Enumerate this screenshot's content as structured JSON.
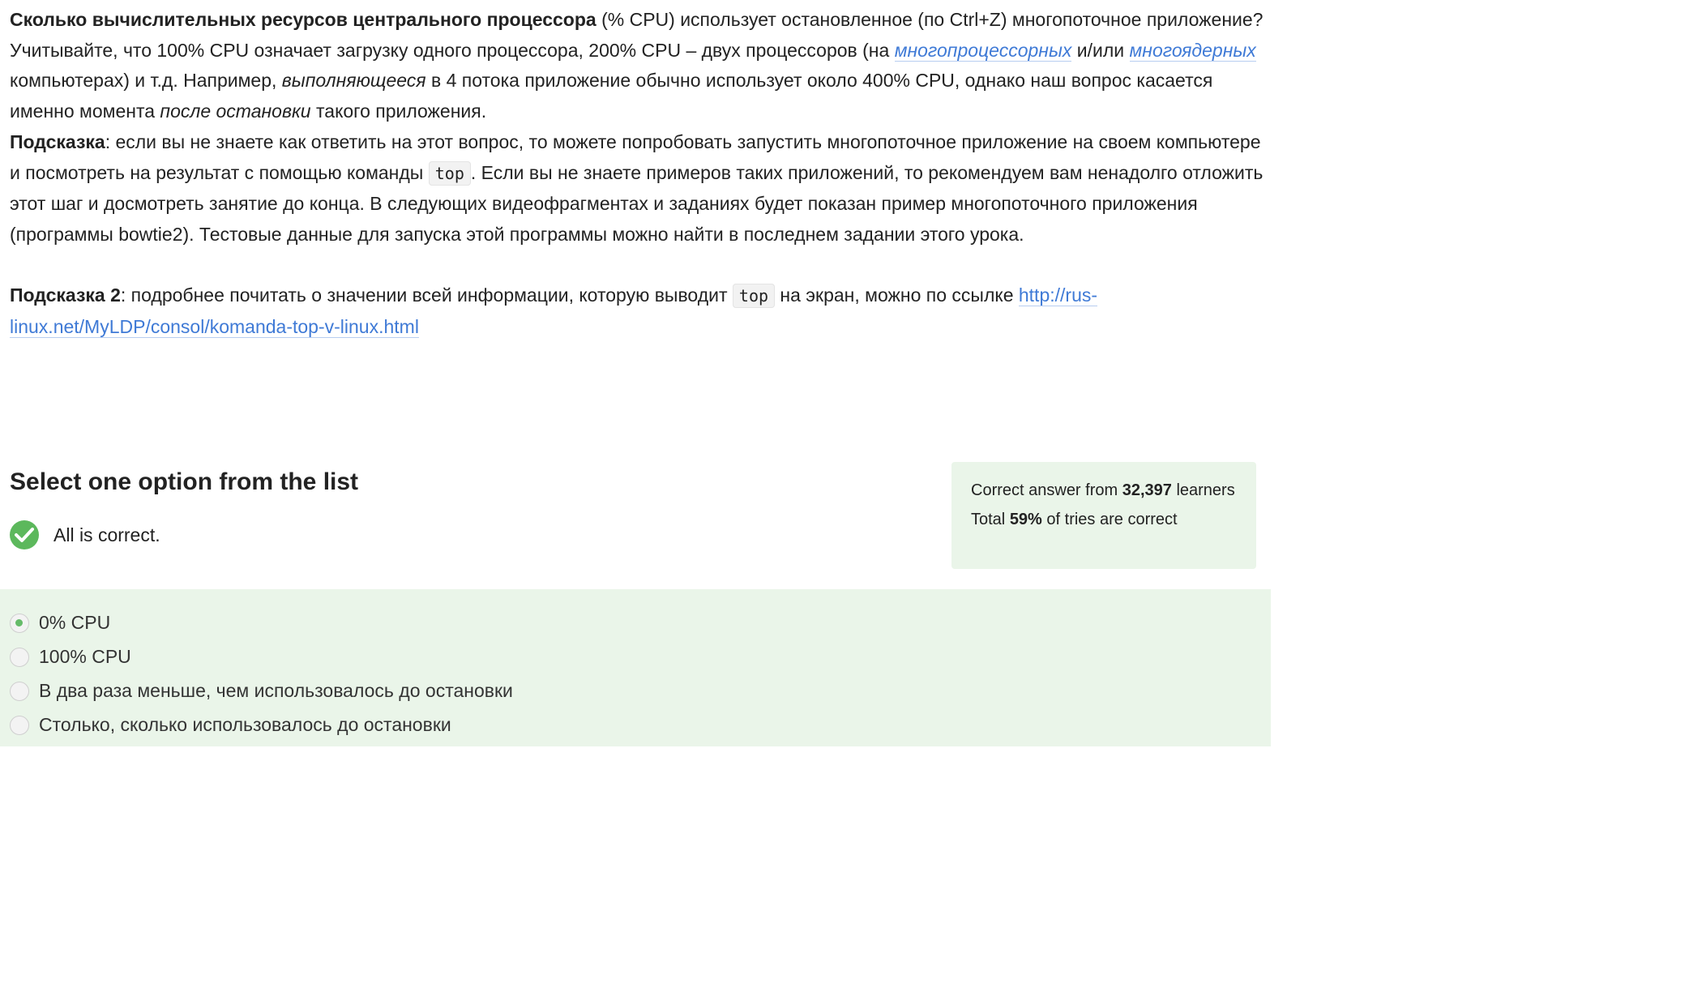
{
  "question": {
    "p1_bold": "Сколько вычислительных ресурсов центрального процессора",
    "p1_rest": " (% CPU) использует остановленное (по Ctrl+Z) многопоточное приложение?",
    "p2_a": "Учитывайте, что 100% CPU означает загрузку одного процессора, 200% CPU – двух процессоров (на ",
    "p2_link1": "многопроцессорных",
    "p2_b": " и/или ",
    "p2_link2": "многоядерных",
    "p2_c": " компьютерах) и т.д. Например, ",
    "p2_italic1": "выполняющееся",
    "p2_d": " в 4 потока приложение обычно использует около 400% CPU, однако наш вопрос касается именно момента ",
    "p2_italic2": "после остановки",
    "p2_e": " такого приложения.",
    "hint1_label": "Подсказка",
    "hint1_a": ": если вы не знаете как ответить на этот вопрос, то можете попробовать запустить многопоточное приложение на своем компьютере и посмотреть на результат с помощью команды ",
    "hint1_code": "top",
    "hint1_b": ". Если вы не знаете примеров таких приложений, то рекомендуем вам ненадолго отложить этот шаг и досмотреть занятие до конца. В следующих видеофрагментах и заданиях будет показан пример многопоточного приложения (программы bowtie2). Тестовые данные для запуска этой программы можно найти в последнем задании этого урока.",
    "hint2_label": "Подсказка 2",
    "hint2_a": ": подробнее почитать о значении всей информации, которую выводит ",
    "hint2_code": "top",
    "hint2_b": " на экран, можно по ссылке ",
    "hint2_link": "http://rus-linux.net/MyLDP/consol/komanda-top-v-linux.html"
  },
  "select_title": "Select one option from the list",
  "result": {
    "text": "All is correct.",
    "icon": "check-circle-icon"
  },
  "stats": {
    "prefix": "Correct answer from ",
    "count": "32,397",
    "suffix": " learners",
    "total_prefix": "Total ",
    "percent": "59%",
    "total_suffix": " of tries are correct"
  },
  "options": [
    {
      "label": "0% CPU",
      "checked": true
    },
    {
      "label": "100% CPU",
      "checked": false
    },
    {
      "label": "В два раза меньше, чем использовалось до остановки",
      "checked": false
    },
    {
      "label": "Столько, сколько использовалось до остановки",
      "checked": false
    }
  ],
  "colors": {
    "link": "#3f7ad6",
    "success": "#5cb85c",
    "panel_bg": "#eaf5e9"
  }
}
